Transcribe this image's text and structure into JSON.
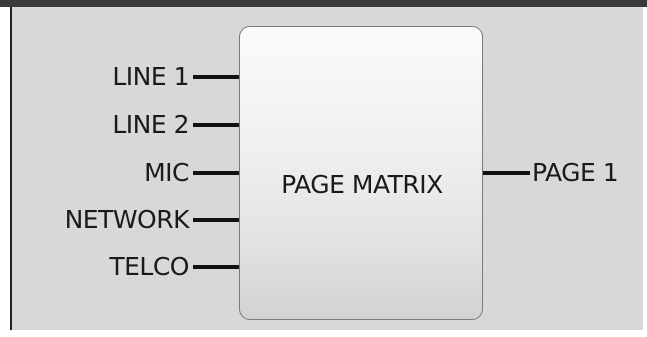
{
  "diagram": {
    "block_label": "PAGE MATRIX",
    "inputs": [
      {
        "label": "LINE 1"
      },
      {
        "label": "LINE 2"
      },
      {
        "label": "MIC"
      },
      {
        "label": "NETWORK"
      },
      {
        "label": "TELCO"
      }
    ],
    "outputs": [
      {
        "label": "PAGE 1"
      }
    ]
  },
  "colors": {
    "canvas": "#d8d8d8",
    "wire": "#111111",
    "block_border": "#7a7a7a",
    "text": "#1a1a1a"
  }
}
